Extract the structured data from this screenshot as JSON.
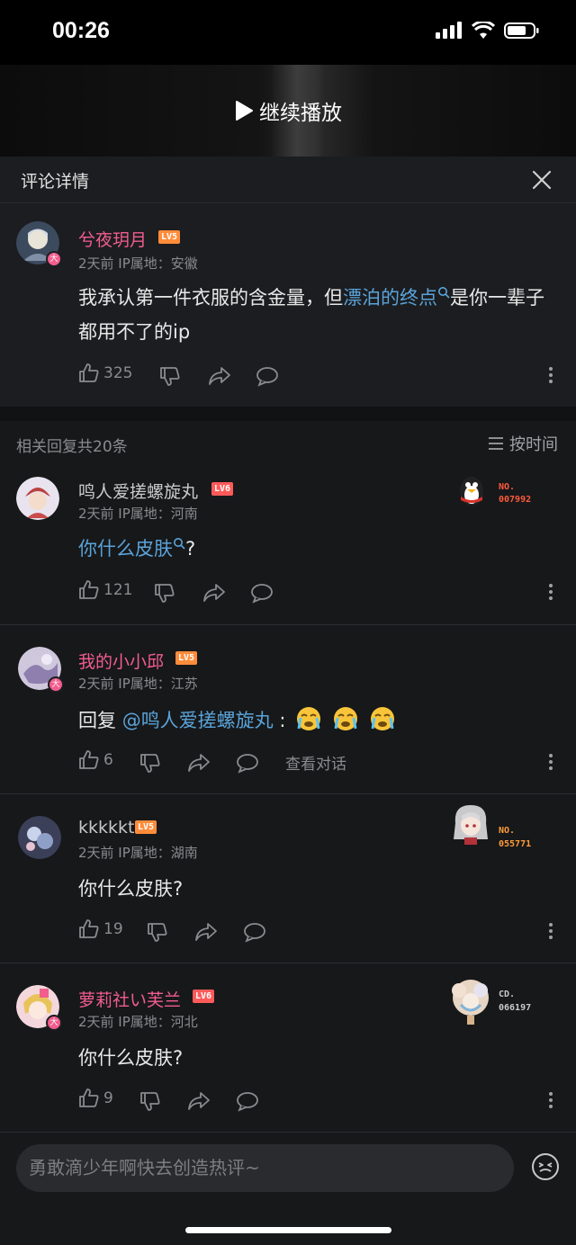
{
  "status_bar": {
    "time": "00:26"
  },
  "video": {
    "resume_label": "继续播放"
  },
  "header": {
    "title": "评论详情"
  },
  "main_comment": {
    "username": "兮夜玥月",
    "level": "LV5",
    "meta": "2天前 IP属地：安徽",
    "content_before": "我承认第一件衣服的含金量，但",
    "content_link": "漂泊的终点",
    "content_after": "是你一辈子都用不了的ip",
    "likes": "325"
  },
  "replies_header": {
    "count_label": "相关回复共20条",
    "sort_label": "按时间"
  },
  "replies": [
    {
      "username": "鸣人爱搓螺旋丸",
      "level": "LV6",
      "meta": "2天前 IP属地：河南",
      "content_link": "你什么皮肤",
      "content_after": "?",
      "likes": "121",
      "fan_badge": {
        "label": "NO.",
        "number": "007992"
      }
    },
    {
      "username": "我的小小邱",
      "level": "LV5",
      "meta": "2天前 IP属地：江苏",
      "content_prefix": "回复 ",
      "content_mention": "@鸣人爱搓螺旋丸",
      "content_after": " :",
      "likes": "6",
      "view_conversation": "查看对话"
    },
    {
      "username": "kkkkktou",
      "level": "LV5",
      "meta": "2天前 IP属地：湖南",
      "content": "你什么皮肤?",
      "likes": "19",
      "fan_badge": {
        "label": "NO.",
        "number": "055771"
      }
    },
    {
      "username": "萝莉社い芙兰",
      "level": "LV6",
      "meta": "2天前 IP属地：河北",
      "content": "你什么皮肤?",
      "likes": "9",
      "fan_badge": {
        "label": "CD.",
        "number": "066197"
      }
    }
  ],
  "input": {
    "placeholder": "勇敢滴少年啊快去创造热评~"
  },
  "colors": {
    "accent_pink": "#f25d8e",
    "link_blue": "#5aa3d9",
    "lv5": "#ff8c3a",
    "lv6": "#ff5a5a"
  }
}
